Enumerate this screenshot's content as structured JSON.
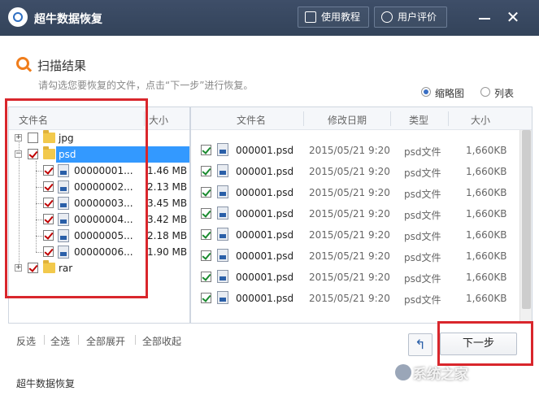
{
  "window": {
    "title": "超牛数据恢复"
  },
  "titlebar": {
    "tutorial_label": "使用教程",
    "rate_label": "用户评价",
    "close_glyph": "✕"
  },
  "header": {
    "title": "扫描结果",
    "subtitle": "请勾选您要恢复的文件，点击“下一步”进行恢复。"
  },
  "view": {
    "thumbnail_label": "缩略图",
    "list_label": "列表",
    "selected": "缩略图"
  },
  "tree": {
    "col_name": "文件名",
    "col_size": "大小",
    "nodes": [
      {
        "label": "jpg",
        "checked": false,
        "expanded": false
      },
      {
        "label": "psd",
        "checked": true,
        "expanded": true,
        "selected": true
      },
      {
        "label": "rar",
        "checked": true,
        "expanded": false
      }
    ],
    "children": [
      {
        "name": "00000001...",
        "size": "1.46 MB"
      },
      {
        "name": "00000002...",
        "size": "2.13 MB"
      },
      {
        "name": "00000003...",
        "size": "3.45 MB"
      },
      {
        "name": "00000004...",
        "size": "3.42 MB"
      },
      {
        "name": "00000005...",
        "size": "2.18 MB"
      },
      {
        "name": "00000006...",
        "size": "1.90 MB"
      }
    ]
  },
  "files": {
    "col_name": "文件名",
    "col_date": "修改日期",
    "col_type": "类型",
    "col_size": "大小",
    "rows": [
      {
        "name": "000001.psd",
        "date": "2015/05/21 9:20",
        "type": "psd文件",
        "size": "1,660KB"
      },
      {
        "name": "000001.psd",
        "date": "2015/05/21 9:20",
        "type": "psd文件",
        "size": "1,660KB"
      },
      {
        "name": "000001.psd",
        "date": "2015/05/21 9:20",
        "type": "psd文件",
        "size": "1,660KB"
      },
      {
        "name": "000001.psd",
        "date": "2015/05/21 9:20",
        "type": "psd文件",
        "size": "1,660KB"
      },
      {
        "name": "000001.psd",
        "date": "2015/05/21 9:20",
        "type": "psd文件",
        "size": "1,660KB"
      },
      {
        "name": "000001.psd",
        "date": "2015/05/21 9:20",
        "type": "psd文件",
        "size": "1,660KB"
      },
      {
        "name": "000001.psd",
        "date": "2015/05/21 9:20",
        "type": "psd文件",
        "size": "1,660KB"
      },
      {
        "name": "000001.psd",
        "date": "2015/05/21 9:20",
        "type": "psd文件",
        "size": "1,660KB"
      }
    ]
  },
  "actions": {
    "invert": "反选",
    "select_all": "全选",
    "expand_all": "全部展开",
    "collapse_all": "全部收起",
    "back_glyph": "↰",
    "next": "下一步"
  },
  "footer": {
    "app_name": "超牛数据恢复",
    "watermark": "系统之家"
  },
  "colors": {
    "titlebar": "#3a4a63",
    "highlight": "#d9262c",
    "selection": "#3399ff",
    "accent": "#f07d1b"
  }
}
